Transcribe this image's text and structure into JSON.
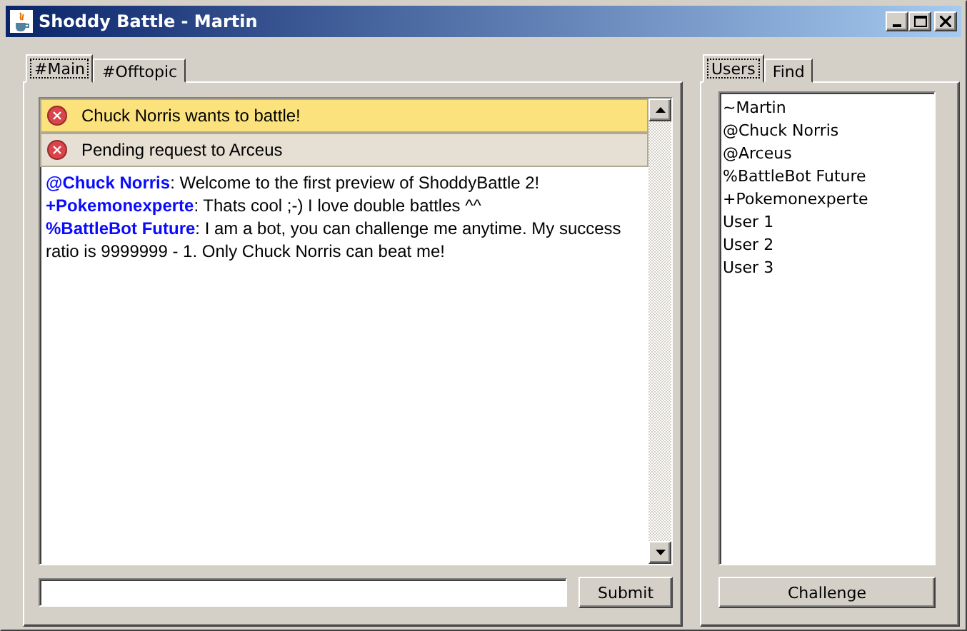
{
  "window": {
    "title": "Shoddy Battle - Martin"
  },
  "chat_tabs": [
    {
      "label": "#Main",
      "selected": true
    },
    {
      "label": "#Offtopic",
      "selected": false
    }
  ],
  "notifications": [
    {
      "kind": "incoming",
      "text": "Chuck Norris wants to battle!"
    },
    {
      "kind": "pending",
      "text": "Pending request to Arceus"
    }
  ],
  "messages": [
    {
      "user": "@Chuck Norris",
      "text": ": Welcome to the first preview of ShoddyBattle 2!"
    },
    {
      "user": "+Pokemonexperte",
      "text": ": Thats cool ;-) I love double battles ^^"
    },
    {
      "user": "%BattleBot Future",
      "text": ": I am a bot, you can challenge me anytime. My success ratio is 9999999 - 1. Only Chuck Norris can beat me!"
    }
  ],
  "submit_button": "Submit",
  "side_tabs": [
    {
      "label": "Users",
      "selected": true
    },
    {
      "label": "Find",
      "selected": false
    }
  ],
  "users": [
    "~Martin",
    "@Chuck Norris",
    "@Arceus",
    "%BattleBot Future",
    "+Pokemonexperte",
    "User 1",
    "User 2",
    "User 3"
  ],
  "challenge_button": "Challenge"
}
